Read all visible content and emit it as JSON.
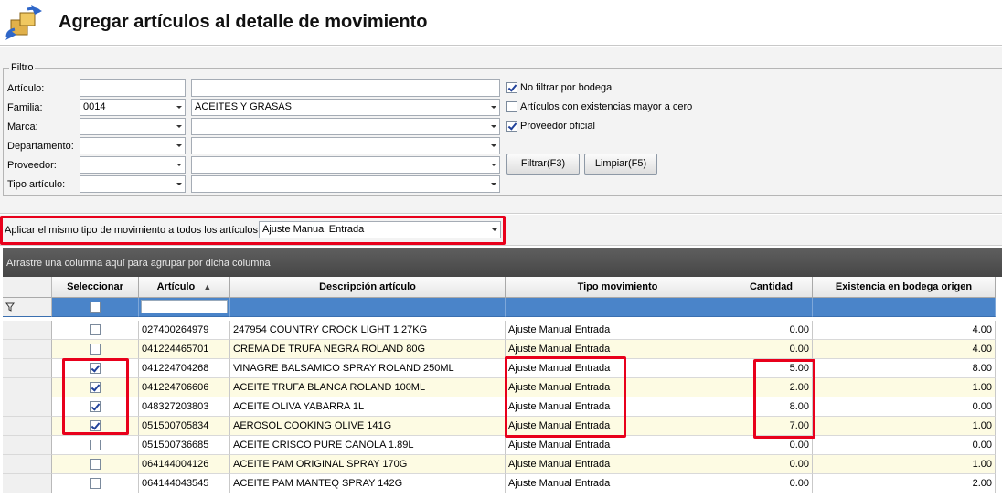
{
  "header": {
    "title": "Agregar artículos al detalle de movimiento"
  },
  "filter": {
    "legend": "Filtro",
    "fields": [
      {
        "label": "Artículo:",
        "code": "",
        "desc": "",
        "combo": false
      },
      {
        "label": "Familia:",
        "code": "0014",
        "desc": "ACEITES Y GRASAS",
        "combo": true
      },
      {
        "label": "Marca:",
        "code": "",
        "desc": "",
        "combo": true
      },
      {
        "label": "Departamento:",
        "code": "",
        "desc": "",
        "combo": true
      },
      {
        "label": "Proveedor:",
        "code": "",
        "desc": "",
        "combo": true
      },
      {
        "label": "Tipo artículo:",
        "code": "",
        "desc": "",
        "combo": true
      }
    ],
    "options": [
      {
        "label": "No filtrar por bodega",
        "checked": true
      },
      {
        "label": "Artículos con existencias mayor a cero",
        "checked": false
      },
      {
        "label": "Proveedor oficial",
        "checked": true
      }
    ],
    "filter_button": "Filtrar(F3)",
    "clear_button": "Limpiar(F5)"
  },
  "apply": {
    "label": "Aplicar el mismo tipo de movimiento a todos los artículos",
    "value": "Ajuste Manual Entrada"
  },
  "grid": {
    "group_hint": "Arrastre una columna aquí para agrupar por dicha columna",
    "columns": [
      "Seleccionar",
      "Artículo",
      "Descripción artículo",
      "Tipo movimiento",
      "Cantidad",
      "Existencia en bodega origen"
    ],
    "sort_indicator": "▲",
    "rows": [
      {
        "selected": false,
        "articulo": "027400264979",
        "descripcion": "247954 COUNTRY CROCK LIGHT 1.27KG",
        "tipo": "Ajuste Manual Entrada",
        "cantidad": "0.00",
        "existencia": "4.00"
      },
      {
        "selected": false,
        "articulo": "041224465701",
        "descripcion": "CREMA DE TRUFA NEGRA ROLAND 80G",
        "tipo": "Ajuste Manual Entrada",
        "cantidad": "0.00",
        "existencia": "4.00"
      },
      {
        "selected": true,
        "articulo": "041224704268",
        "descripcion": "VINAGRE BALSAMICO SPRAY ROLAND 250ML",
        "tipo": "Ajuste Manual Entrada",
        "cantidad": "5.00",
        "existencia": "8.00"
      },
      {
        "selected": true,
        "articulo": "041224706606",
        "descripcion": "ACEITE TRUFA BLANCA ROLAND 100ML",
        "tipo": "Ajuste Manual Entrada",
        "cantidad": "2.00",
        "existencia": "1.00"
      },
      {
        "selected": true,
        "articulo": "048327203803",
        "descripcion": "ACEITE OLIVA YABARRA 1L",
        "tipo": "Ajuste Manual Entrada",
        "cantidad": "8.00",
        "existencia": "0.00"
      },
      {
        "selected": true,
        "articulo": "051500705834",
        "descripcion": "AEROSOL COOKING OLIVE 141G",
        "tipo": "Ajuste Manual Entrada",
        "cantidad": "7.00",
        "existencia": "1.00"
      },
      {
        "selected": false,
        "articulo": "051500736685",
        "descripcion": "ACEITE CRISCO PURE CANOLA 1.89L",
        "tipo": "Ajuste Manual Entrada",
        "cantidad": "0.00",
        "existencia": "0.00"
      },
      {
        "selected": false,
        "articulo": "064144004126",
        "descripcion": "ACEITE PAM ORIGINAL SPRAY 170G",
        "tipo": "Ajuste Manual Entrada",
        "cantidad": "0.00",
        "existencia": "1.00"
      },
      {
        "selected": false,
        "articulo": "064144043545",
        "descripcion": "ACEITE PAM MANTEQ SPRAY 142G",
        "tipo": "Ajuste Manual Entrada",
        "cantidad": "0.00",
        "existencia": "2.00"
      }
    ]
  },
  "colors": {
    "highlight": "#e8001b",
    "filter_row": "#4a84c9",
    "group_panel": "#505050"
  }
}
